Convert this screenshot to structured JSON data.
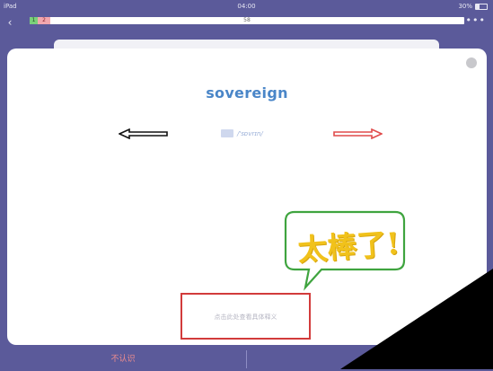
{
  "status_bar": {
    "device": "iPad",
    "time": "04:00",
    "battery": "30%"
  },
  "progress": {
    "learned": "1",
    "unknown": "2",
    "total": "58"
  },
  "card": {
    "word": "sovereign",
    "phonetic": "/'sɒvrɪn/",
    "hint": "点击此处查看具体释义",
    "annotation": "太棒了!"
  },
  "bottom_bar": {
    "unknown_label": "不认识",
    "known_label": ""
  },
  "colors": {
    "background": "#5b5a9a",
    "word": "#4a86c8",
    "hint_box": "#d23b3b",
    "bubble_outline": "#3fa43f",
    "bubble_text": "#f1c21b",
    "right_arrow": "#e04a4a",
    "left_arrow": "#111111"
  },
  "icons": {
    "back": "chevron-left-icon",
    "more": "more-dots-icon",
    "speaker": "speaker-icon",
    "refresh": "refresh-icon"
  }
}
